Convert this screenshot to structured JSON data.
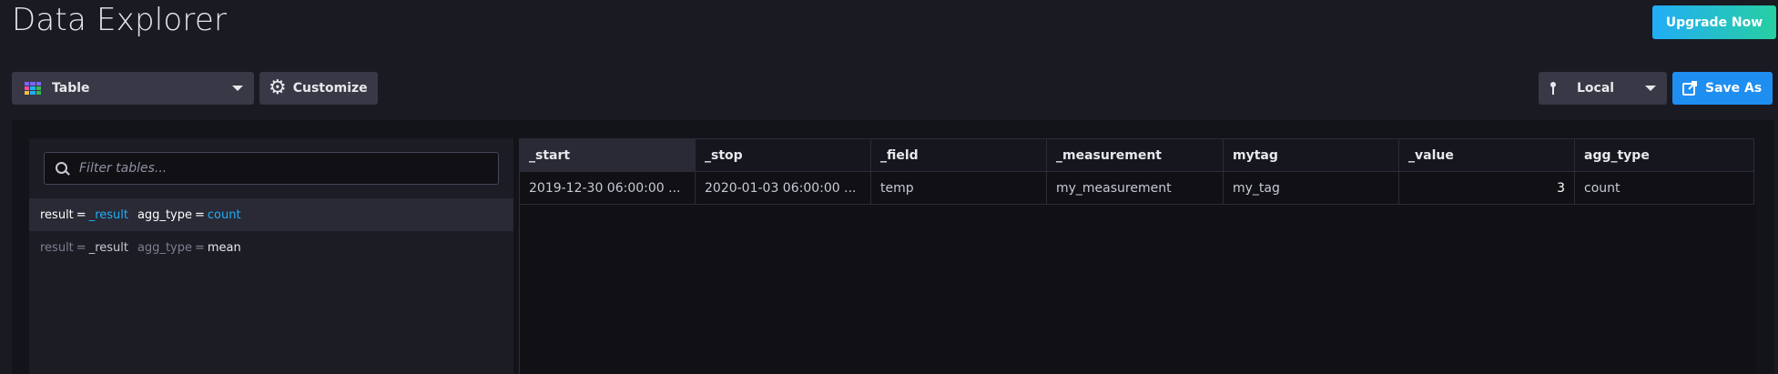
{
  "header": {
    "title": "Data Explorer",
    "upgrade_label": "Upgrade Now"
  },
  "toolbar": {
    "view_type": "Table",
    "customize_label": "Customize",
    "bucket_label": "Local",
    "save_as_label": "Save As"
  },
  "filter": {
    "placeholder": "Filter tables..."
  },
  "result_tables": [
    {
      "result_key": "result",
      "result_value": "_result",
      "agg_key": "agg_type",
      "agg_value": "count",
      "selected": true
    },
    {
      "result_key": "result",
      "result_value": "_result",
      "agg_key": "agg_type",
      "agg_value": "mean",
      "selected": false
    }
  ],
  "table": {
    "columns": [
      "_start",
      "_stop",
      "_field",
      "_measurement",
      "mytag",
      "_value",
      "agg_type"
    ],
    "rows": [
      [
        "2019-12-30 06:00:00 ...",
        "2020-01-03 06:00:00 ...",
        "temp",
        "my_measurement",
        "my_tag",
        "3",
        "count"
      ]
    ]
  },
  "colors": {
    "accent": "#22adf6",
    "save_button": "#1f8ef1",
    "upgrade_gradient_start": "#22adf6",
    "upgrade_gradient_end": "#27cfa2"
  },
  "icons": {
    "view_type": "table-icon",
    "customize": "gear-icon",
    "bucket": "pin-icon",
    "save_as": "export-icon",
    "filter": "search-icon"
  }
}
